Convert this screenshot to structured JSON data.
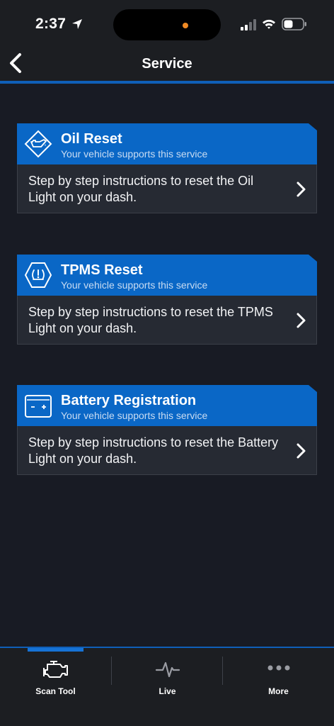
{
  "status_bar": {
    "time": "2:37"
  },
  "nav": {
    "title": "Service"
  },
  "services": [
    {
      "title": "Oil Reset",
      "subtitle": "Your vehicle supports this service",
      "description": "Step by step instructions to reset the Oil Light on your dash.",
      "icon": "oil-can-icon"
    },
    {
      "title": "TPMS Reset",
      "subtitle": "Your vehicle supports this service",
      "description": "Step by step instructions to reset the TPMS Light on your dash.",
      "icon": "tpms-icon"
    },
    {
      "title": "Battery Registration",
      "subtitle": "Your vehicle supports this service",
      "description": "Step by step instructions to reset the Battery Light on your dash.",
      "icon": "battery-icon"
    }
  ],
  "tabs": [
    {
      "label": "Scan Tool",
      "icon": "engine-icon",
      "active": true
    },
    {
      "label": "Live",
      "icon": "pulse-icon",
      "active": false
    },
    {
      "label": "More",
      "icon": "more-dots-icon",
      "active": false
    }
  ],
  "colors": {
    "accent": "#0a67c6",
    "background": "#181b24",
    "card_body": "#262a33"
  }
}
